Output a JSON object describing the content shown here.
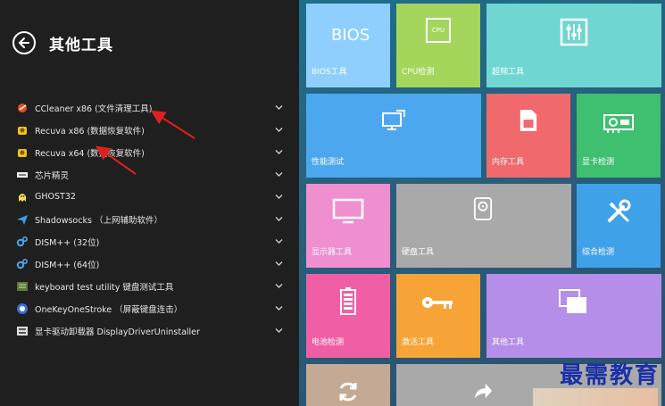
{
  "left_panel": {
    "title": "其他工具",
    "items": [
      {
        "label": "CCleaner x86 (文件清理工具)",
        "icon": "ccleaner-icon"
      },
      {
        "label": "Recuva x86 (数据恢复软件)",
        "icon": "recuva-icon"
      },
      {
        "label": "Recuva x64 (数据恢复软件)",
        "icon": "recuva-icon"
      },
      {
        "label": "芯片精灵",
        "icon": "chip-icon"
      },
      {
        "label": "GHOST32",
        "icon": "ghost-icon"
      },
      {
        "label": "Shadowsocks （上网辅助软件）",
        "icon": "paper-plane-icon"
      },
      {
        "label": "DISM++ (32位)",
        "icon": "gear-icon"
      },
      {
        "label": "DISM++ (64位)",
        "icon": "gear-icon"
      },
      {
        "label": "keyboard test utility 键盘测试工具",
        "icon": "keyboard-icon"
      },
      {
        "label": "OneKeyOneStroke （屏蔽键盘连击）",
        "icon": "onekey-icon"
      },
      {
        "label": "显卡驱动卸载器 DisplayDriverUninstaller",
        "icon": "display-driver-icon"
      }
    ]
  },
  "tiles": {
    "bios": {
      "label": "BIOS工具",
      "big_text": "BIOS",
      "color": "#8fcfff"
    },
    "cpu": {
      "label": "CPU检测",
      "chip_text": "CPU",
      "color": "#a3d65b"
    },
    "overclock": {
      "label": "超频工具",
      "color": "#6fd6d2"
    },
    "performance": {
      "label": "性能测试",
      "color": "#4da7ee"
    },
    "memory": {
      "label": "内存工具",
      "color": "#f0696c"
    },
    "gpu": {
      "label": "显卡检测",
      "color": "#3ec070"
    },
    "monitor": {
      "label": "显示器工具",
      "color": "#f08fd0"
    },
    "disk": {
      "label": "硬盘工具",
      "color": "#a9a9a9"
    },
    "integrated": {
      "label": "综合检测",
      "color": "#3fa2e8"
    },
    "battery": {
      "label": "电池检测",
      "color": "#f05fa5"
    },
    "activation": {
      "label": "激活工具",
      "color": "#f6a437"
    },
    "other": {
      "label": "其他工具",
      "color": "#b48ee8"
    },
    "refresh": {
      "label": "",
      "color": "#c4a994"
    },
    "share": {
      "label": "",
      "color": "#a9a9a9"
    }
  },
  "watermark": {
    "text": "最需教育"
  },
  "colors": {
    "accent_arrow": "#e02020",
    "panel_bg": "#1f1f1f"
  }
}
